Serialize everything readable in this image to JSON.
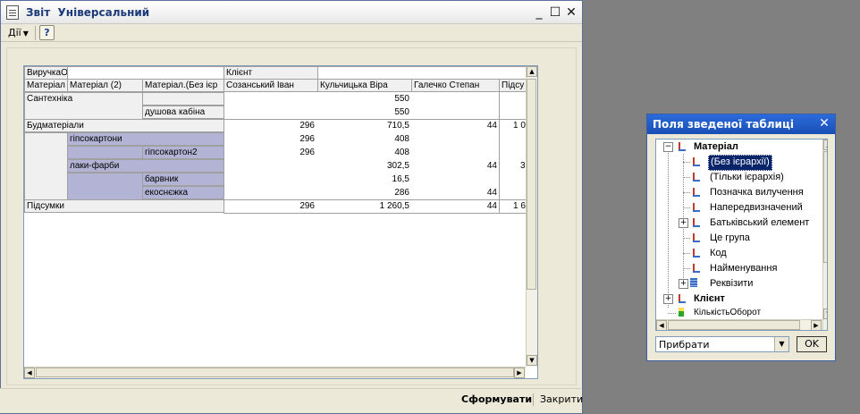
{
  "window": {
    "title": "Звіт  Універсальний",
    "minimize": "_",
    "maximize": "☐",
    "close": "✕"
  },
  "toolbar": {
    "actions_label": "Дії",
    "help_label": "?"
  },
  "grid": {
    "top_row": [
      "ВиручкаО",
      "",
      "",
      "Клієнт",
      ""
    ],
    "header_row": [
      "Матеріал",
      "Матеріал (2)",
      "Матеріал.(Без ієр",
      "Созанський Іван",
      "Кульчицька Віра",
      "Галечко Степан",
      "Підсу"
    ],
    "rows": [
      {
        "c1": "Сантехніка",
        "c2": "",
        "c3": "",
        "v1": "",
        "v2": "550",
        "v3": "",
        "v4": ""
      },
      {
        "c1": "",
        "c2": "",
        "c3": "душова кабіна",
        "v1": "",
        "v2": "550",
        "v3": "",
        "v4": ""
      },
      {
        "c1": "Будматеріали",
        "c2": "",
        "c3": "",
        "v1": "296",
        "v2": "710,5",
        "v3": "44",
        "v4": "1 0"
      },
      {
        "c1": "",
        "c2": "гіпсокартони",
        "c3": "",
        "v1": "296",
        "v2": "408",
        "v3": "",
        "v4": ""
      },
      {
        "c1": "",
        "c2": "",
        "c3": "гіпсокартон2",
        "v1": "296",
        "v2": "408",
        "v3": "",
        "v4": ""
      },
      {
        "c1": "",
        "c2": "лаки-фарби",
        "c3": "",
        "v1": "",
        "v2": "302,5",
        "v3": "44",
        "v4": "3"
      },
      {
        "c1": "",
        "c2": "",
        "c3": "барвник",
        "v1": "",
        "v2": "16,5",
        "v3": "",
        "v4": ""
      },
      {
        "c1": "",
        "c2": "",
        "c3": "екоснєжка",
        "v1": "",
        "v2": "286",
        "v3": "44",
        "v4": ""
      },
      {
        "c1": "Підсумки",
        "c2": "",
        "c3": "",
        "v1": "296",
        "v2": "1 260,5",
        "v3": "44",
        "v4": "1 6"
      }
    ]
  },
  "bottom": {
    "form_label": "Сформувати",
    "close_label": "Закрити"
  },
  "panel": {
    "title": "Поля зведеної таблиці",
    "close": "✕",
    "tree": [
      {
        "label": "Матеріал",
        "bold": true
      },
      {
        "label": "(Без ієрархії)",
        "selected": true
      },
      {
        "label": "(Тільки ієрархія)"
      },
      {
        "label": "Позначка вилучення"
      },
      {
        "label": "Напередвизначений"
      },
      {
        "label": "Батьківський елемент"
      },
      {
        "label": "Це група"
      },
      {
        "label": "Код"
      },
      {
        "label": "Найменування"
      },
      {
        "label": "Реквізити"
      },
      {
        "label": "Клієнт",
        "bold": true
      },
      {
        "label": "КількістьОборот"
      }
    ],
    "combo_value": "Прибрати",
    "ok_label": "OK"
  },
  "colors": {
    "highlight": "#b3b3d6",
    "header": "#f0f0f0",
    "selection": "#0a246a",
    "title_blue": "#1a4fb4"
  }
}
